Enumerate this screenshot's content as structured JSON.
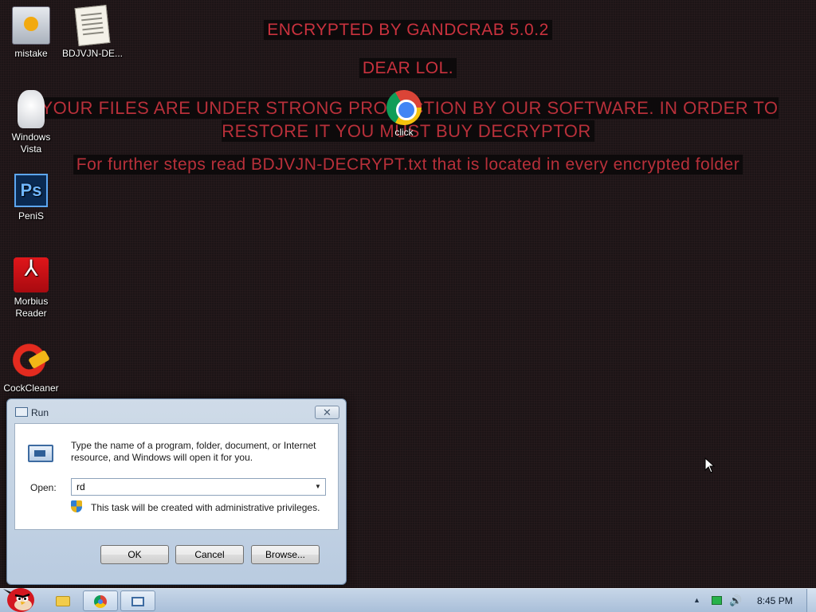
{
  "wallpaper": {
    "line1": "ENCRYPTED BY GANDCRAB 5.0.2",
    "line2": "DEAR LOL.",
    "line3": "YOUR FILES ARE UNDER STRONG PROTECTION BY OUR SOFTWARE. IN ORDER TO RESTORE IT YOU MUST BUY DECRYPTOR",
    "line4": "For further steps read BDJVJN-DECRYPT.txt that is located in every encrypted folder"
  },
  "desktop_icons": [
    {
      "label": "mistake",
      "icon": "computer-icon"
    },
    {
      "label": "BDJVJN-DE...",
      "icon": "document-icon"
    },
    {
      "label": "Windows Vista",
      "icon": "recycle-bin-icon"
    },
    {
      "label": "PeniS",
      "icon": "photoshop-icon"
    },
    {
      "label": "Morbius Reader",
      "icon": "pdf-reader-icon"
    },
    {
      "label": "CockCleaner",
      "icon": "ccleaner-icon"
    },
    {
      "label": "click",
      "icon": "chrome-icon"
    }
  ],
  "run_dialog": {
    "title": "Run",
    "close_glyph": "✕",
    "description": "Type the name of a program, folder, document, or Internet resource, and Windows will open it for you.",
    "open_label": "Open:",
    "open_value": "rd",
    "admin_note": "This task will be created with administrative privileges.",
    "ok_label": "OK",
    "cancel_label": "Cancel",
    "browse_label": "Browse..."
  },
  "taskbar": {
    "clock": "8:45 PM",
    "tray_arrow": "▲",
    "volume_glyph": "🔊"
  },
  "colors": {
    "ransom_red": "#c9323e",
    "taskbar": "#c7d6e8"
  }
}
